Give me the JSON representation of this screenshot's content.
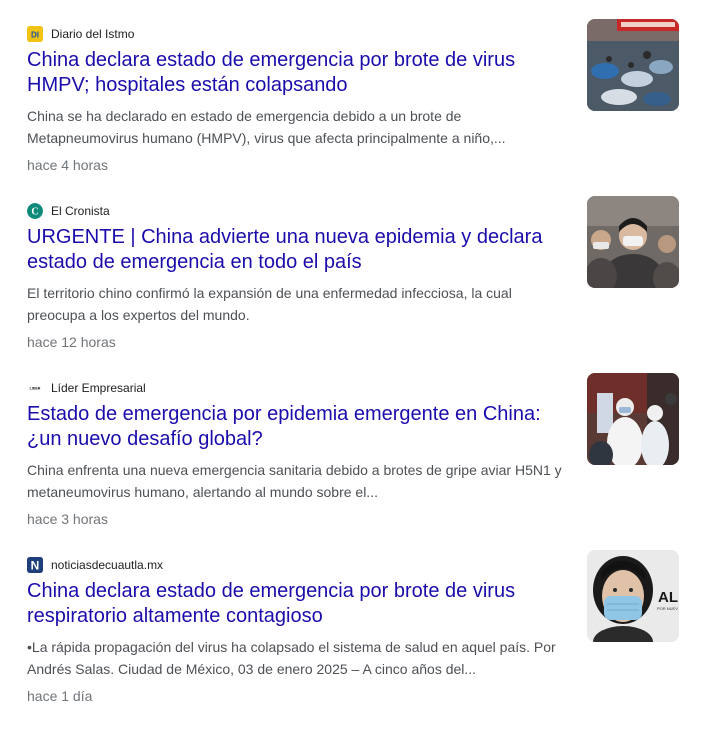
{
  "articles": [
    {
      "source": "Diario del Istmo",
      "source_icon": "diario-del-istmo-logo",
      "title": "China declara estado de emergencia por brote de virus HMPV; hospitales están colapsando",
      "snippet": "China se ha declarado en estado de emergencia debido a un brote de Metapneumovirus humano (HMPV), virus que afecta principalmente a niño,...",
      "time": "hace 4 horas",
      "favicon_text": "DI",
      "favicon_color": "#f2c314"
    },
    {
      "source": "El Cronista",
      "source_icon": "el-cronista-logo",
      "title": "URGENTE | China advierte una nueva epidemia y declara estado de emergencia en todo el país",
      "snippet": "El territorio chino confirmó la expansión de una enfermedad infecciosa, la cual preocupa a los expertos del mundo.",
      "time": "hace 12 horas",
      "favicon_text": "C",
      "favicon_color": "#0e8a7a"
    },
    {
      "source": "Líder Empresarial",
      "source_icon": "lider-empresarial-logo",
      "title": "Estado de emergencia por epidemia emergente en China: ¿un nuevo desafío global?",
      "snippet": "China enfrenta una nueva emergencia sanitaria debido a brotes de gripe aviar H5N1 y metaneumovirus humano, alertando al mundo sobre el...",
      "time": "hace 3 horas",
      "favicon_text": "LIDER",
      "favicon_color": "#ffffff"
    },
    {
      "source": "noticiasdecuautla.mx",
      "source_icon": "noticias-de-cuautla-logo",
      "title": "China declara estado de emergencia por brote de virus respiratorio altamente contagioso",
      "snippet": "•La rápida propagación del virus ha colapsado el sistema de salud en aquel país. Por Andrés Salas. Ciudad de México, 03 de enero 2025 – A cinco años del...",
      "time": "hace 1 día",
      "favicon_text": "N",
      "favicon_color": "#1f3f7a",
      "thumb_text": "AL",
      "thumb_subtext": "POR NUEV"
    }
  ],
  "colors": {
    "link": "#1a0dab",
    "snippet": "#4d5156",
    "meta": "#70757a"
  }
}
